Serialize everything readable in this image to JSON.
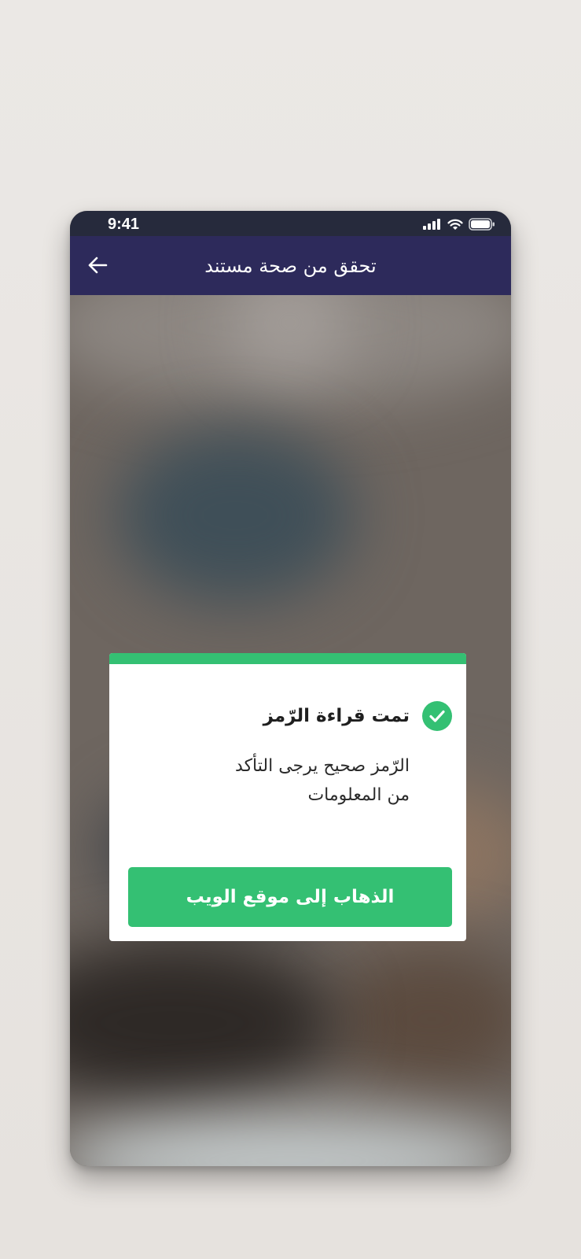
{
  "status_bar": {
    "time": "9:41",
    "icons": [
      "signal-icon",
      "wifi-icon",
      "battery-icon"
    ]
  },
  "header": {
    "title": "تحقق من صحة مستند",
    "back_icon": "arrow-left-icon"
  },
  "dialog": {
    "title": "تمت قراءة الرّمز",
    "message_line1": "الرّمز صحيح يرجى التأكد",
    "message_line2": "من المعلومات",
    "button_label": "الذهاب  إلى موقع الويب",
    "status_icon": "check-circle-icon"
  },
  "colors": {
    "header": "#2d2a5b",
    "status_bar": "#262a3c",
    "accent": "#34c073",
    "background": "#ebe8e5"
  }
}
